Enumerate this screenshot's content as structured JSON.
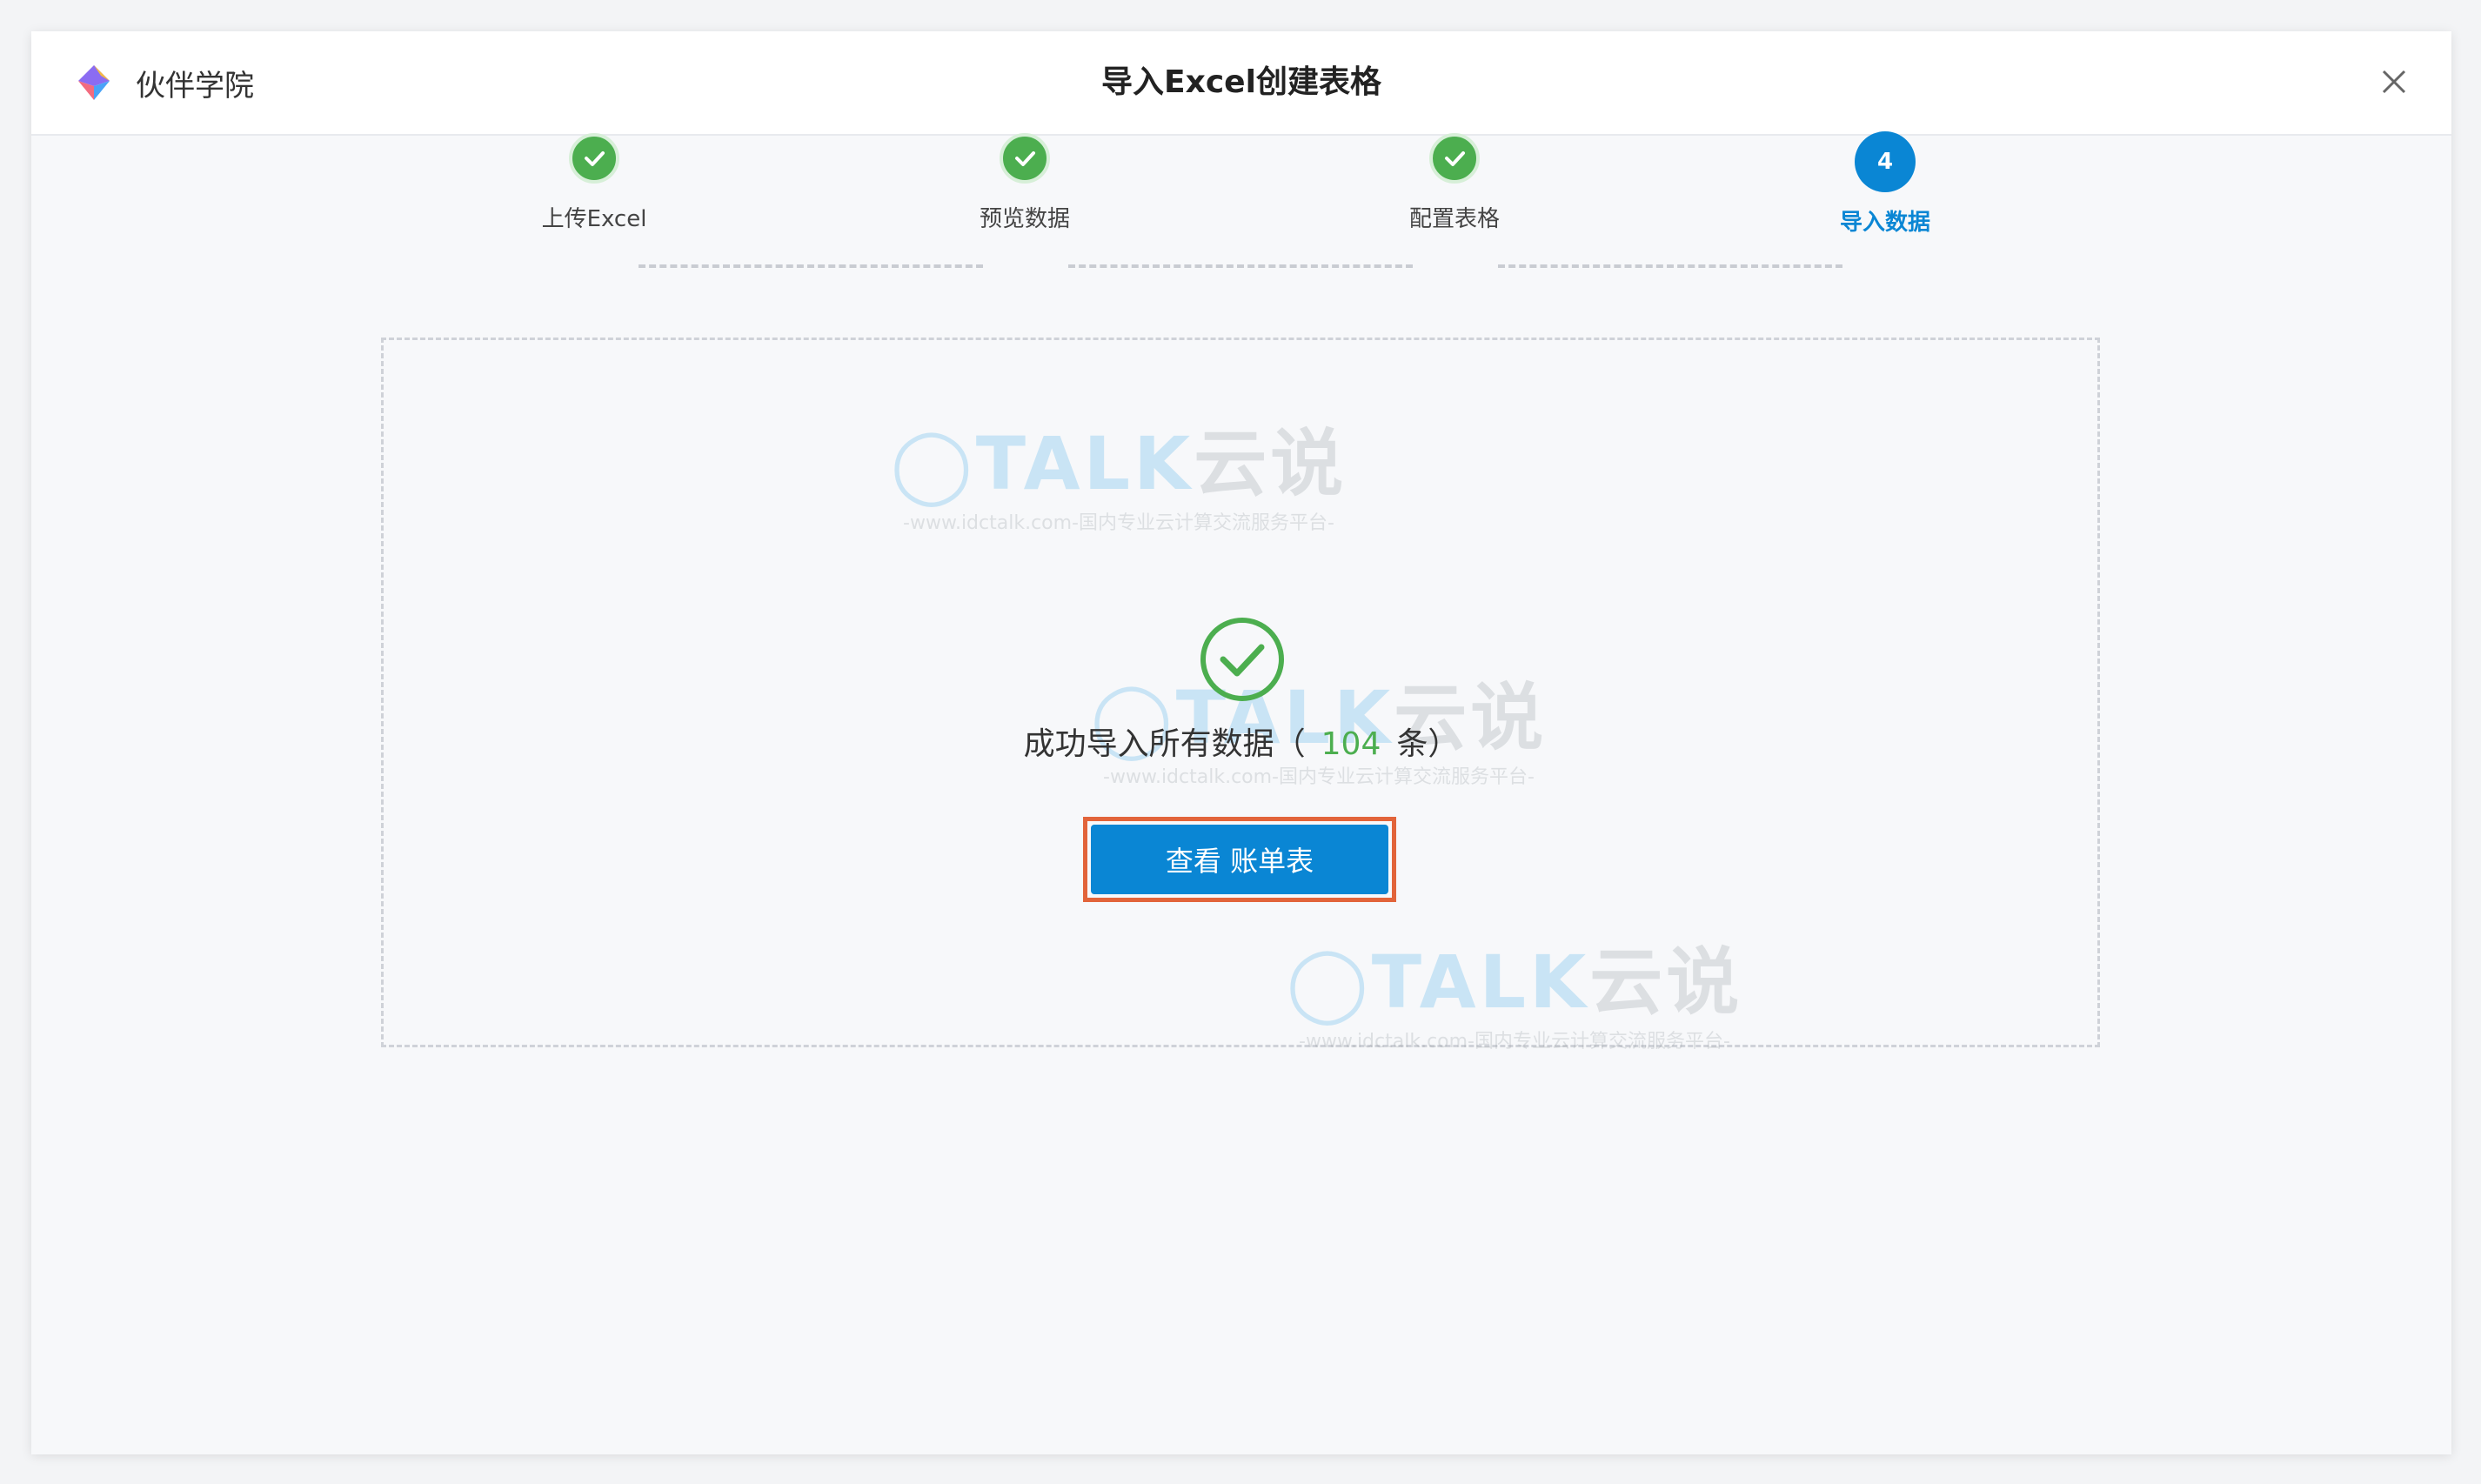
{
  "header": {
    "brand_name": "伙伴学院",
    "title": "导入Excel创建表格"
  },
  "steps": [
    {
      "label": "上传Excel",
      "status": "done"
    },
    {
      "label": "预览数据",
      "status": "done"
    },
    {
      "label": "配置表格",
      "status": "done"
    },
    {
      "label": "导入数据",
      "status": "active",
      "number": "4"
    }
  ],
  "result": {
    "prefix": "成功导入所有数据（",
    "count": "104",
    "suffix": "条）",
    "button_label": "查看 账单表"
  },
  "watermark": {
    "main_prefix": "TALK",
    "main_cn": "云说",
    "sub": "-www.idctalk.com-国内专业云计算交流服务平台-"
  },
  "colors": {
    "accent": "#0a86d4",
    "success": "#4cae4f",
    "highlight": "#e2643a"
  }
}
